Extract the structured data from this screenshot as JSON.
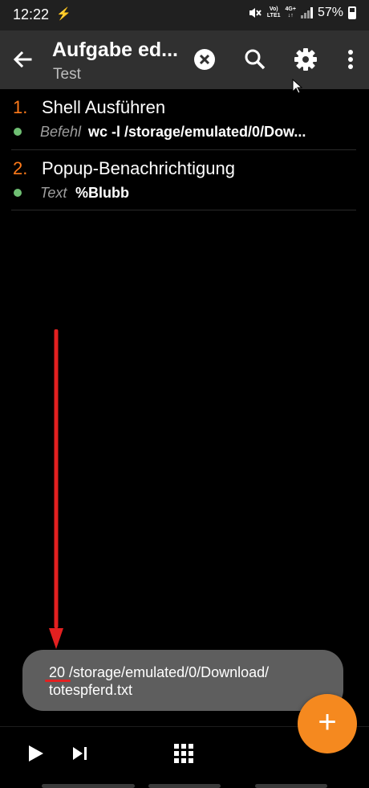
{
  "status_bar": {
    "time": "12:22",
    "bolt_icon": "⚡",
    "volte_line1": "Vo)",
    "volte_line2": "LTE1",
    "net_line1": "4G+",
    "net_line2": "↓↑",
    "battery_percent": "57%"
  },
  "app_bar": {
    "title": "Aufgabe ed...",
    "subtitle": "Test",
    "icons": [
      "back-arrow-icon",
      "cancel-icon",
      "search-icon",
      "settings-gear-icon",
      "overflow-menu-icon"
    ]
  },
  "actions": [
    {
      "number": "1.",
      "name": "Shell Ausführen",
      "param_label": "Befehl",
      "param_value": "wc -l /storage/emulated/0/Dow..."
    },
    {
      "number": "2.",
      "name": "Popup-Benachrichtigung",
      "param_label": "Text",
      "param_value": "%Blubb"
    }
  ],
  "toast": {
    "line1": "20 /storage/emulated/0/Download/",
    "line2": "totespferd.txt"
  },
  "fab": {
    "label": "+"
  },
  "bottom_bar": {
    "icons": [
      "play-icon",
      "skip-next-icon",
      "grid-icon"
    ]
  },
  "colors": {
    "accent": "#f5891f",
    "action_number": "#ff7a1a",
    "param_dot": "#6fbf73",
    "annotation": "#e32020"
  }
}
